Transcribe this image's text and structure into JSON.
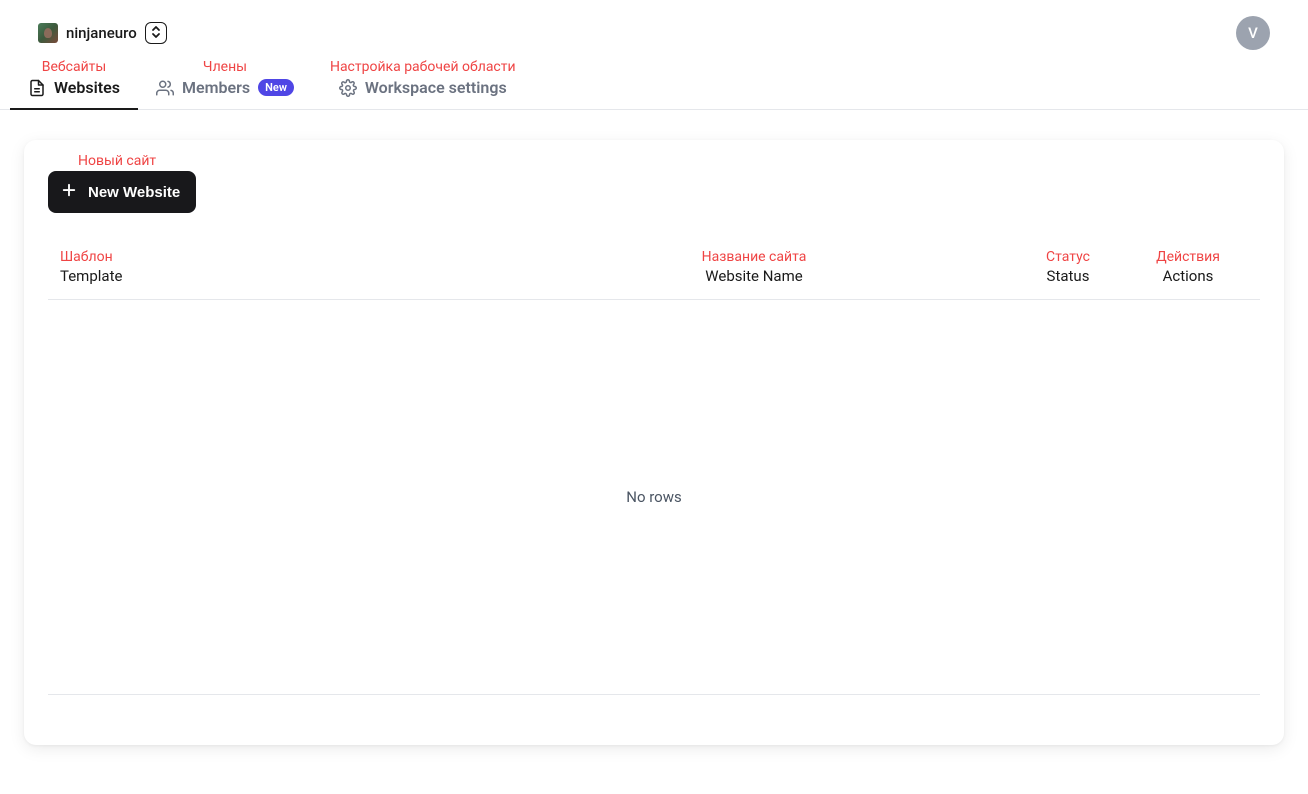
{
  "header": {
    "workspace_name": "ninjaneuro",
    "avatar_initial": "V"
  },
  "tabs": {
    "websites": {
      "annotation": "Вебсайты",
      "label": "Websites"
    },
    "members": {
      "annotation": "Члены",
      "label": "Members",
      "badge": "New"
    },
    "settings": {
      "annotation": "Настройка рабочей области",
      "label": "Workspace settings"
    }
  },
  "card": {
    "new_website_annotation": "Новый сайт",
    "new_website_label": "New Website"
  },
  "table": {
    "columns": {
      "template": {
        "annotation": "Шаблон",
        "label": "Template"
      },
      "name": {
        "annotation": "Название сайта",
        "label": "Website Name"
      },
      "status": {
        "annotation": "Статус",
        "label": "Status"
      },
      "actions": {
        "annotation": "Действия",
        "label": "Actions"
      }
    },
    "empty_text": "No rows"
  }
}
